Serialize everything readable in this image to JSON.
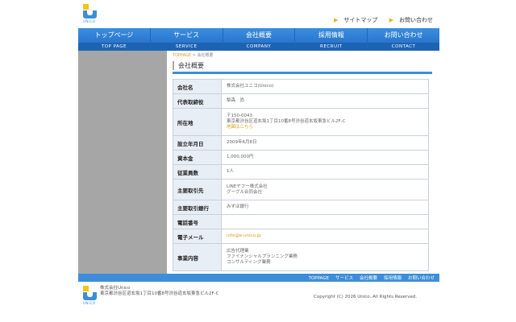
{
  "header": {
    "logo_text": "UNICO",
    "sitemap": "サイトマップ",
    "contact": "お問い合わせ"
  },
  "nav": [
    {
      "jp": "トップページ",
      "en": "TOP PAGE"
    },
    {
      "jp": "サービス",
      "en": "SERVICE"
    },
    {
      "jp": "会社概要",
      "en": "COMPANY"
    },
    {
      "jp": "採用情報",
      "en": "RECRUIT"
    },
    {
      "jp": "お問い合わせ",
      "en": "CONTACT"
    }
  ],
  "breadcrumb": {
    "home": "TOPPAGE",
    "sep": " > ",
    "current": "会社概要"
  },
  "page_title": "会社概要",
  "table": [
    {
      "k": "会社名",
      "v": [
        "株式会社ユニコ(Unico)"
      ]
    },
    {
      "k": "代表取締役",
      "v": [
        "梨森　尚"
      ]
    },
    {
      "k": "所在地",
      "v": [
        "〒150-0043",
        "東京都渋谷区道玄坂1丁目10番8号渋谷道玄坂東急ビル2F-C"
      ],
      "link": "地図はこちら"
    },
    {
      "k": "設立年月日",
      "v": [
        "2009年6月8日"
      ]
    },
    {
      "k": "資本金",
      "v": [
        "1,000,000円"
      ]
    },
    {
      "k": "従業員数",
      "v": [
        "1人"
      ]
    },
    {
      "k": "主要取引先",
      "v": [
        "LINEヤフー株式会社",
        "グーグル合同会社"
      ]
    },
    {
      "k": "主要取引銀行",
      "v": [
        "みずほ銀行"
      ]
    },
    {
      "k": "電話番号",
      "v": [
        ""
      ]
    },
    {
      "k": "電子メール",
      "v": [],
      "link": "info@e-unico.jp"
    },
    {
      "k": "事業内容",
      "v": [
        "広告代理業",
        "ファイナンシャルプランニング業務",
        "コンサルティング業務"
      ]
    }
  ],
  "footer": {
    "links": [
      "TOPPAGE",
      "サービス",
      "会社概要",
      "採用情報",
      "お問い合わせ"
    ],
    "company": "株式会社Unico",
    "address": "東京都渋谷区道玄坂1丁目10番8号渋谷道玄坂東急ビル2F-C",
    "copyright": "Copyright (C) 2026 Unico. All Rights Reserved."
  },
  "colors": {
    "accent": "#3c8ed8",
    "nav_dark": "#1e63b3",
    "link": "#d4a21a",
    "sidebar": "#a6a6a6"
  }
}
